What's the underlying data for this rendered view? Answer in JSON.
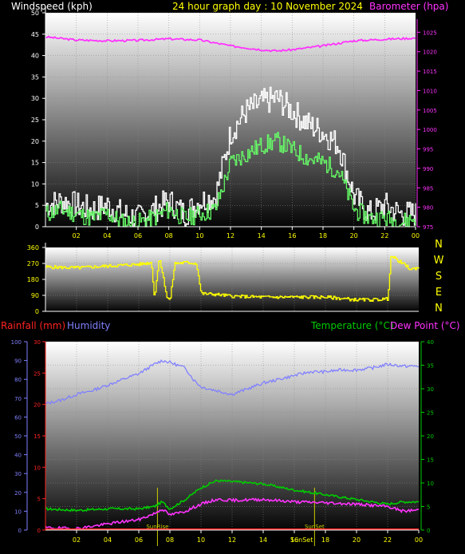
{
  "header": {
    "title": "24 hour graph day : 10 November 2024",
    "wind_label": "Windspeed (kph)",
    "baro_label": "Barometer (hpa)"
  },
  "lower_header": {
    "rain_label": "Rainfall (mm)",
    "hum_label": "Humidity",
    "temp_label": "Temperature (°C)",
    "dew_label": "Dew Point (°C)"
  },
  "colors": {
    "title": "#ffff00",
    "wind_gust": "#ffffff",
    "wind_avg": "#66ff66",
    "baro": "#ff33ff",
    "direction": "#ffff00",
    "rain": "#ff2222",
    "humidity": "#8080ff",
    "temperature": "#00cc00",
    "dewpoint": "#ff33ff",
    "sun": "#cccc00"
  },
  "chart_data": [
    {
      "type": "line",
      "name": "wind-baro",
      "x_ticks": [
        "02",
        "04",
        "06",
        "08",
        "10",
        "12",
        "14",
        "16",
        "18",
        "20",
        "22",
        "00"
      ],
      "ylim_left": [
        0,
        50
      ],
      "yticks_left": [
        0,
        5,
        10,
        15,
        20,
        25,
        30,
        35,
        40,
        45,
        50
      ],
      "ylim_right": [
        975,
        1030
      ],
      "yticks_right": [
        975,
        980,
        985,
        990,
        995,
        1000,
        1005,
        1010,
        1015,
        1020,
        1025
      ],
      "series": [
        {
          "key": "gust",
          "x": [
            0,
            1,
            2,
            3,
            4,
            5,
            6,
            7,
            8,
            9,
            10,
            11,
            12,
            13,
            14,
            15,
            16,
            17,
            18,
            19,
            20,
            21,
            22,
            23,
            24
          ],
          "values": [
            5,
            6,
            5,
            4,
            5,
            3,
            2,
            4,
            6,
            3,
            6,
            7,
            22,
            27,
            29,
            30,
            27,
            24,
            22,
            19,
            7,
            3,
            5,
            3,
            3
          ]
        },
        {
          "key": "avg",
          "x": [
            0,
            1,
            2,
            3,
            4,
            5,
            6,
            7,
            8,
            9,
            10,
            11,
            12,
            13,
            14,
            15,
            16,
            17,
            18,
            19,
            20,
            21,
            22,
            23,
            24
          ],
          "values": [
            3,
            4,
            3,
            2,
            3,
            1,
            1,
            2,
            4,
            2,
            3,
            4,
            15,
            17,
            19,
            20,
            18,
            16,
            15,
            13,
            4,
            2,
            2,
            1,
            2
          ]
        },
        {
          "key": "baro",
          "x": [
            0,
            2,
            4,
            6,
            8,
            10,
            12,
            14,
            15,
            16,
            18,
            20,
            22,
            24
          ],
          "values": [
            1023.8,
            1023,
            1022.8,
            1022.9,
            1023.3,
            1023,
            1021.5,
            1020.5,
            1020.2,
            1020.5,
            1021.5,
            1022.8,
            1023.2,
            1023.5
          ]
        }
      ]
    },
    {
      "type": "line",
      "name": "wind-direction",
      "x_ticks": [],
      "ylim": [
        0,
        360
      ],
      "yticks": [
        0,
        90,
        180,
        270,
        360
      ],
      "compass": [
        "N",
        "W",
        "S",
        "E",
        "N"
      ],
      "series": [
        {
          "key": "dir",
          "x": [
            0,
            2,
            4,
            5,
            6,
            6.8,
            7,
            7.3,
            7.8,
            8,
            8.3,
            9,
            9.7,
            10,
            11,
            12,
            14,
            16,
            18,
            20,
            21,
            22,
            22.2,
            22.7,
            23.5,
            24
          ],
          "values": [
            250,
            245,
            255,
            260,
            265,
            275,
            70,
            310,
            80,
            60,
            270,
            275,
            270,
            100,
            95,
            85,
            80,
            80,
            80,
            65,
            65,
            70,
            310,
            285,
            235,
            250
          ]
        }
      ]
    },
    {
      "type": "line",
      "name": "temp-humidity",
      "x_ticks": [
        "02",
        "04",
        "06",
        "08",
        "10",
        "12",
        "14",
        "16",
        "18",
        "20",
        "22",
        "00"
      ],
      "ylim_humidity": [
        0,
        100
      ],
      "yticks_humidity": [
        0,
        10,
        20,
        30,
        40,
        50,
        60,
        70,
        80,
        90,
        100
      ],
      "ylim_rain": [
        0,
        30
      ],
      "yticks_rain": [
        0,
        5,
        10,
        15,
        20,
        25,
        30
      ],
      "ylim_temp": [
        0,
        40
      ],
      "yticks_temp": [
        0,
        5,
        10,
        15,
        20,
        25,
        30,
        35,
        40
      ],
      "sun_events": [
        {
          "label": "SunRise",
          "x": 7.2
        },
        {
          "label": "SunSet",
          "x": 17.3
        }
      ],
      "sun_label_bottom": "SunSet",
      "series": [
        {
          "key": "humidity",
          "x": [
            0,
            1,
            2,
            3,
            4,
            5,
            6,
            7,
            7.5,
            8,
            9,
            9.5,
            10,
            11,
            12,
            13,
            14,
            15,
            16,
            17,
            18,
            19,
            20,
            21,
            22,
            23,
            24
          ],
          "values": [
            67,
            69,
            72,
            74,
            77,
            80,
            83,
            88,
            90,
            89,
            86,
            80,
            76,
            74,
            72,
            75,
            78,
            80,
            82,
            84,
            84,
            85,
            85,
            86,
            88,
            87,
            87
          ]
        },
        {
          "key": "temperature",
          "x": [
            0,
            2,
            4,
            6,
            7,
            7.5,
            8,
            9,
            10,
            11,
            12,
            14,
            16,
            18,
            20,
            22,
            23,
            24
          ],
          "values": [
            4.5,
            4.2,
            4.5,
            4.5,
            5,
            6,
            4.5,
            6.5,
            9,
            10.5,
            10.3,
            9.8,
            8.5,
            7.5,
            6.5,
            5.5,
            6,
            6
          ]
        },
        {
          "key": "dewpoint",
          "x": [
            0,
            2,
            3,
            4,
            5,
            6,
            7,
            7.5,
            8,
            9,
            10,
            11,
            12,
            14,
            16,
            18,
            20,
            22,
            23,
            24
          ],
          "values": [
            0.5,
            0.3,
            0.8,
            1.3,
            1.8,
            2.2,
            3.5,
            4.5,
            3.2,
            4,
            5.5,
            6.5,
            6.3,
            6.5,
            6,
            5.8,
            5.5,
            5,
            4,
            4.3
          ]
        },
        {
          "key": "rain",
          "x": [
            0,
            24
          ],
          "values": [
            0,
            0
          ]
        }
      ]
    }
  ]
}
